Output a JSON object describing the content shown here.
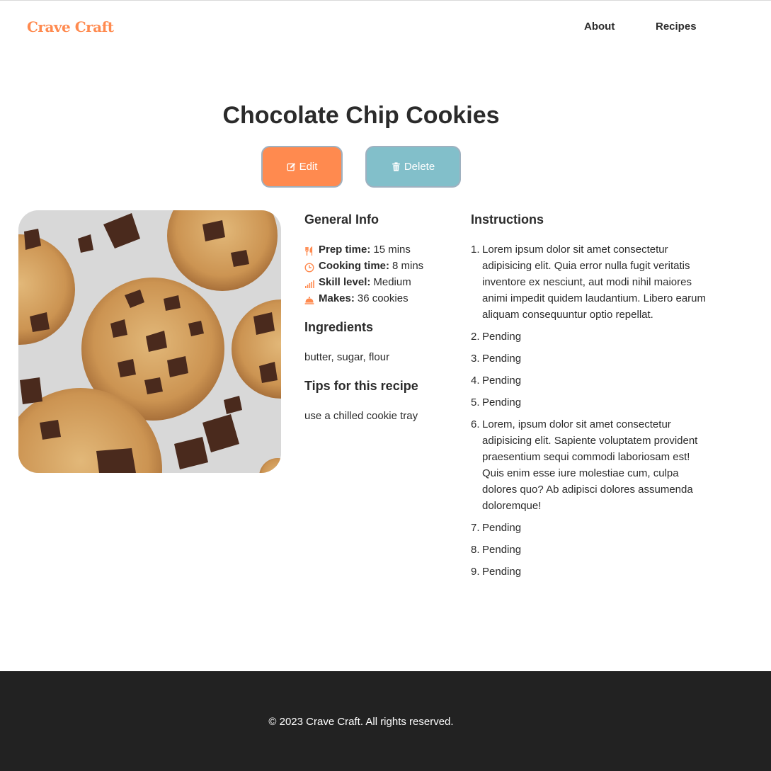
{
  "colors": {
    "accent": "#ff8a4f",
    "secondary": "#82bfca",
    "text": "#2b2b2b",
    "footer_bg": "#222222"
  },
  "header": {
    "brand": "Crave Craft",
    "nav": [
      {
        "label": "About"
      },
      {
        "label": "Recipes"
      }
    ]
  },
  "recipe": {
    "title": "Chocolate Chip Cookies",
    "actions": {
      "edit_label": "Edit",
      "edit_icon": "edit-icon",
      "delete_label": "Delete",
      "delete_icon": "trash-icon"
    },
    "general_info": {
      "heading": "General Info",
      "items": [
        {
          "icon": "utensils-icon",
          "label": "Prep time:",
          "value": "15 mins"
        },
        {
          "icon": "clock-icon",
          "label": "Cooking time:",
          "value": "8 mins"
        },
        {
          "icon": "signal-icon",
          "label": "Skill level:",
          "value": "Medium"
        },
        {
          "icon": "cloche-icon",
          "label": "Makes:",
          "value": "36 cookies"
        }
      ]
    },
    "ingredients": {
      "heading": "Ingredients",
      "text": "butter, sugar, flour"
    },
    "tips": {
      "heading": "Tips for this recipe",
      "text": "use a chilled cookie tray"
    },
    "instructions": {
      "heading": "Instructions",
      "steps": [
        {
          "num": "1.",
          "text": "Lorem ipsum dolor sit amet consectetur adipisicing elit. Quia error nulla fugit veritatis inventore ex nesciunt, aut modi nihil maiores animi impedit quidem laudantium. Libero earum aliquam consequuntur optio repellat."
        },
        {
          "num": "2.",
          "text": "Pending"
        },
        {
          "num": "3.",
          "text": "Pending"
        },
        {
          "num": "4.",
          "text": "Pending"
        },
        {
          "num": "5.",
          "text": "Pending"
        },
        {
          "num": "6.",
          "text": "Lorem, ipsum dolor sit amet consectetur adipisicing elit. Sapiente voluptatem provident praesentium sequi commodi laboriosam est! Quis enim esse iure molestiae cum, culpa dolores quo? Ab adipisci dolores assumenda doloremque!"
        },
        {
          "num": "7.",
          "text": "Pending"
        },
        {
          "num": "8.",
          "text": "Pending"
        },
        {
          "num": "9.",
          "text": "Pending"
        }
      ]
    }
  },
  "footer": {
    "copyright": "© 2023 Crave Craft. All rights reserved."
  }
}
